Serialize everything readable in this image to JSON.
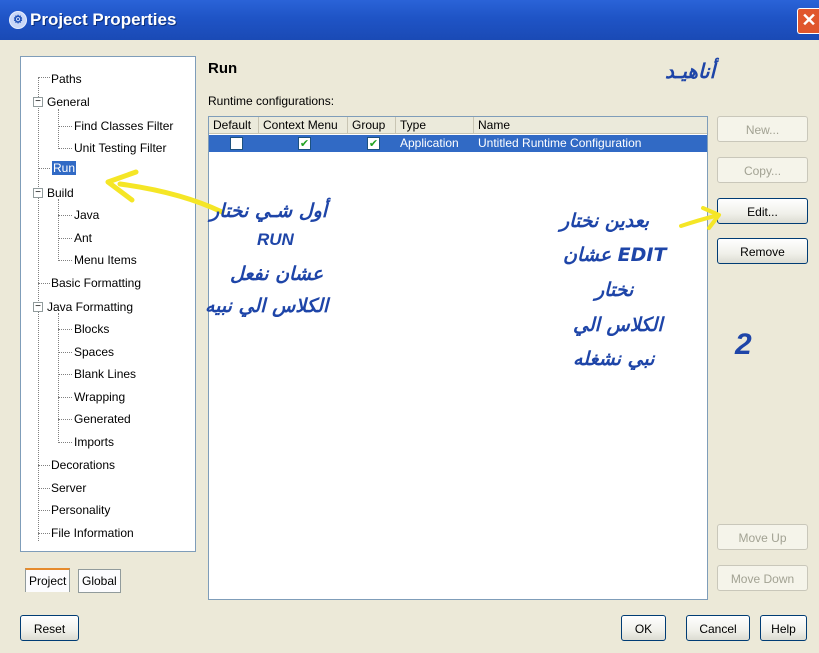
{
  "window": {
    "title": "Project Properties",
    "icon": "app-icon",
    "close_glyph": "✕"
  },
  "tree": {
    "items": [
      {
        "label": "Paths"
      },
      {
        "label": "General"
      },
      {
        "label": "Find Classes Filter"
      },
      {
        "label": "Unit Testing Filter"
      },
      {
        "label": "Run"
      },
      {
        "label": "Build"
      },
      {
        "label": "Java"
      },
      {
        "label": "Ant"
      },
      {
        "label": "Menu Items"
      },
      {
        "label": "Basic Formatting"
      },
      {
        "label": "Java Formatting"
      },
      {
        "label": "Blocks"
      },
      {
        "label": "Spaces"
      },
      {
        "label": "Blank Lines"
      },
      {
        "label": "Wrapping"
      },
      {
        "label": "Generated"
      },
      {
        "label": "Imports"
      },
      {
        "label": "Decorations"
      },
      {
        "label": "Server"
      },
      {
        "label": "Personality"
      },
      {
        "label": "File Information"
      }
    ],
    "selected": "Run"
  },
  "tabs": [
    "Project",
    "Global"
  ],
  "main": {
    "section_title": "Run",
    "list_label": "Runtime configurations:",
    "columns": [
      "Default",
      "Context Menu",
      "Group",
      "Type",
      "Name"
    ],
    "rows": [
      {
        "default": false,
        "context_menu": true,
        "group": true,
        "type": "Application",
        "name": "Untitled Runtime Configuration"
      }
    ]
  },
  "side_buttons": {
    "new": "New...",
    "copy": "Copy...",
    "edit": "Edit...",
    "remove": "Remove",
    "move_up": "Move Up",
    "move_down": "Move Down"
  },
  "footer": {
    "reset": "Reset",
    "ok": "OK",
    "cancel": "Cancel",
    "help": "Help"
  },
  "annotations": {
    "author": "أناهيـد",
    "left_line1": "أول شـي نختار",
    "left_line2": "RUN",
    "left_line3": "عشان نفعل",
    "left_line4": "الكلاس الي نبيه",
    "right_line1": "بعدين نختار",
    "right_line2": "EDIT  عشان",
    "right_line3": "نختار",
    "right_line4": "الكلاس الي",
    "right_line5": "نبي نشغله",
    "step_number": "2",
    "arrow_color": "#f5e626"
  }
}
